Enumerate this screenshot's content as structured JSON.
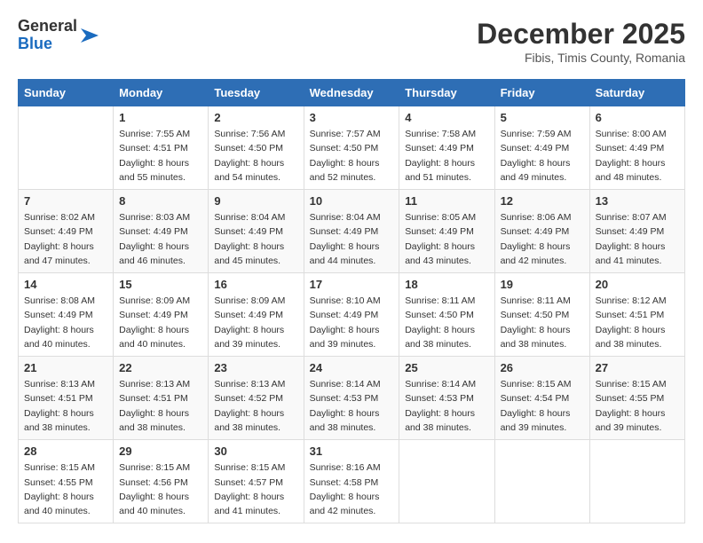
{
  "header": {
    "logo_general": "General",
    "logo_blue": "Blue",
    "month_title": "December 2025",
    "location": "Fibis, Timis County, Romania"
  },
  "weekdays": [
    "Sunday",
    "Monday",
    "Tuesday",
    "Wednesday",
    "Thursday",
    "Friday",
    "Saturday"
  ],
  "weeks": [
    [
      {
        "day": "",
        "info": ""
      },
      {
        "day": "1",
        "info": "Sunrise: 7:55 AM\nSunset: 4:51 PM\nDaylight: 8 hours\nand 55 minutes."
      },
      {
        "day": "2",
        "info": "Sunrise: 7:56 AM\nSunset: 4:50 PM\nDaylight: 8 hours\nand 54 minutes."
      },
      {
        "day": "3",
        "info": "Sunrise: 7:57 AM\nSunset: 4:50 PM\nDaylight: 8 hours\nand 52 minutes."
      },
      {
        "day": "4",
        "info": "Sunrise: 7:58 AM\nSunset: 4:49 PM\nDaylight: 8 hours\nand 51 minutes."
      },
      {
        "day": "5",
        "info": "Sunrise: 7:59 AM\nSunset: 4:49 PM\nDaylight: 8 hours\nand 49 minutes."
      },
      {
        "day": "6",
        "info": "Sunrise: 8:00 AM\nSunset: 4:49 PM\nDaylight: 8 hours\nand 48 minutes."
      }
    ],
    [
      {
        "day": "7",
        "info": "Sunrise: 8:02 AM\nSunset: 4:49 PM\nDaylight: 8 hours\nand 47 minutes."
      },
      {
        "day": "8",
        "info": "Sunrise: 8:03 AM\nSunset: 4:49 PM\nDaylight: 8 hours\nand 46 minutes."
      },
      {
        "day": "9",
        "info": "Sunrise: 8:04 AM\nSunset: 4:49 PM\nDaylight: 8 hours\nand 45 minutes."
      },
      {
        "day": "10",
        "info": "Sunrise: 8:04 AM\nSunset: 4:49 PM\nDaylight: 8 hours\nand 44 minutes."
      },
      {
        "day": "11",
        "info": "Sunrise: 8:05 AM\nSunset: 4:49 PM\nDaylight: 8 hours\nand 43 minutes."
      },
      {
        "day": "12",
        "info": "Sunrise: 8:06 AM\nSunset: 4:49 PM\nDaylight: 8 hours\nand 42 minutes."
      },
      {
        "day": "13",
        "info": "Sunrise: 8:07 AM\nSunset: 4:49 PM\nDaylight: 8 hours\nand 41 minutes."
      }
    ],
    [
      {
        "day": "14",
        "info": "Sunrise: 8:08 AM\nSunset: 4:49 PM\nDaylight: 8 hours\nand 40 minutes."
      },
      {
        "day": "15",
        "info": "Sunrise: 8:09 AM\nSunset: 4:49 PM\nDaylight: 8 hours\nand 40 minutes."
      },
      {
        "day": "16",
        "info": "Sunrise: 8:09 AM\nSunset: 4:49 PM\nDaylight: 8 hours\nand 39 minutes."
      },
      {
        "day": "17",
        "info": "Sunrise: 8:10 AM\nSunset: 4:49 PM\nDaylight: 8 hours\nand 39 minutes."
      },
      {
        "day": "18",
        "info": "Sunrise: 8:11 AM\nSunset: 4:50 PM\nDaylight: 8 hours\nand 38 minutes."
      },
      {
        "day": "19",
        "info": "Sunrise: 8:11 AM\nSunset: 4:50 PM\nDaylight: 8 hours\nand 38 minutes."
      },
      {
        "day": "20",
        "info": "Sunrise: 8:12 AM\nSunset: 4:51 PM\nDaylight: 8 hours\nand 38 minutes."
      }
    ],
    [
      {
        "day": "21",
        "info": "Sunrise: 8:13 AM\nSunset: 4:51 PM\nDaylight: 8 hours\nand 38 minutes."
      },
      {
        "day": "22",
        "info": "Sunrise: 8:13 AM\nSunset: 4:51 PM\nDaylight: 8 hours\nand 38 minutes."
      },
      {
        "day": "23",
        "info": "Sunrise: 8:13 AM\nSunset: 4:52 PM\nDaylight: 8 hours\nand 38 minutes."
      },
      {
        "day": "24",
        "info": "Sunrise: 8:14 AM\nSunset: 4:53 PM\nDaylight: 8 hours\nand 38 minutes."
      },
      {
        "day": "25",
        "info": "Sunrise: 8:14 AM\nSunset: 4:53 PM\nDaylight: 8 hours\nand 38 minutes."
      },
      {
        "day": "26",
        "info": "Sunrise: 8:15 AM\nSunset: 4:54 PM\nDaylight: 8 hours\nand 39 minutes."
      },
      {
        "day": "27",
        "info": "Sunrise: 8:15 AM\nSunset: 4:55 PM\nDaylight: 8 hours\nand 39 minutes."
      }
    ],
    [
      {
        "day": "28",
        "info": "Sunrise: 8:15 AM\nSunset: 4:55 PM\nDaylight: 8 hours\nand 40 minutes."
      },
      {
        "day": "29",
        "info": "Sunrise: 8:15 AM\nSunset: 4:56 PM\nDaylight: 8 hours\nand 40 minutes."
      },
      {
        "day": "30",
        "info": "Sunrise: 8:15 AM\nSunset: 4:57 PM\nDaylight: 8 hours\nand 41 minutes."
      },
      {
        "day": "31",
        "info": "Sunrise: 8:16 AM\nSunset: 4:58 PM\nDaylight: 8 hours\nand 42 minutes."
      },
      {
        "day": "",
        "info": ""
      },
      {
        "day": "",
        "info": ""
      },
      {
        "day": "",
        "info": ""
      }
    ]
  ]
}
